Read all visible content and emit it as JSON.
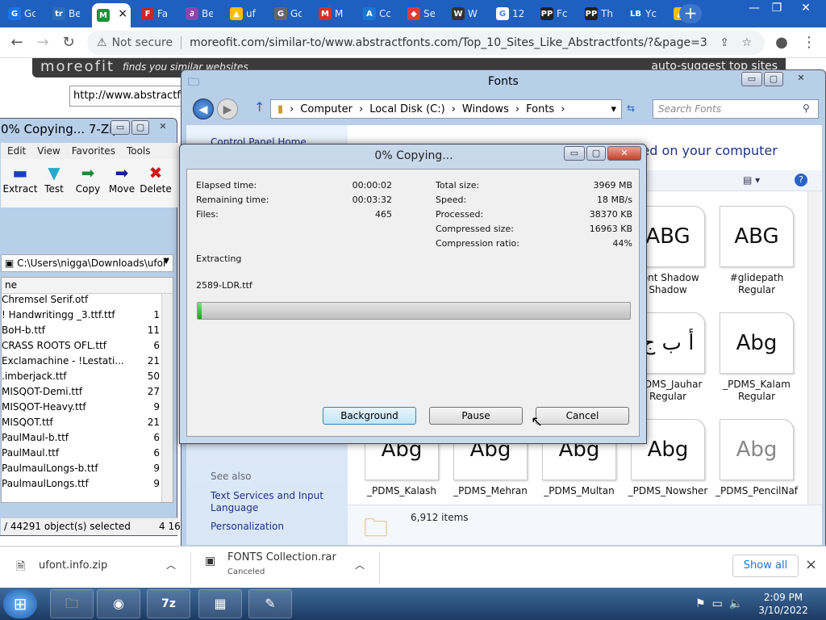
{
  "browser": {
    "tabs": [
      {
        "label": "Gc",
        "fav_color": "#1a73e8",
        "fav_text": "G"
      },
      {
        "label": "Be",
        "fav_color": "#2d6db5",
        "fav_text": "tr"
      },
      {
        "label": "",
        "fav_color": "#1f8f3a",
        "fav_text": "M",
        "active": true
      },
      {
        "label": "Fa",
        "fav_color": "#c62828",
        "fav_text": "F"
      },
      {
        "label": "Be",
        "fav_color": "#8e44ad",
        "fav_text": "∂"
      },
      {
        "label": "uf",
        "fav_color": "#fbbc04",
        "fav_text": "▲"
      },
      {
        "label": "Gc",
        "fav_color": "#666666",
        "fav_text": "G"
      },
      {
        "label": "M",
        "fav_color": "#d93025",
        "fav_text": "M"
      },
      {
        "label": "Cc",
        "fav_color": "#1976d2",
        "fav_text": "A"
      },
      {
        "label": "Se",
        "fav_color": "#e53935",
        "fav_text": "◆"
      },
      {
        "label": "W",
        "fav_color": "#333333",
        "fav_text": "W"
      },
      {
        "label": "12",
        "fav_color": "#ffffff",
        "fav_text": "G"
      },
      {
        "label": "Fc",
        "fav_color": "#222222",
        "fav_text": "PP"
      },
      {
        "label": "Th",
        "fav_color": "#222222",
        "fav_text": "PP"
      },
      {
        "label": "Yc",
        "fav_color": "#1565c0",
        "fav_text": "LB"
      },
      {
        "label": "Ur",
        "fav_color": "#fbbc04",
        "fav_text": "▲"
      }
    ],
    "close_glyph": "×",
    "new_tab": "+",
    "not_secure": "Not secure",
    "url": "moreofit.com/similar-to/www.abstractfonts.com/Top_10_Sites_Like_Abstractfonts/?&page=3"
  },
  "page": {
    "logo": "moreofit",
    "tagline": "finds you similar websites",
    "links": "auto-suggest   top sites",
    "url_box_value": "http://www.abstractfon"
  },
  "zip": {
    "title": "0% Copying... 7-Zip",
    "menu": [
      "Edit",
      "View",
      "Favorites",
      "Tools"
    ],
    "tools": [
      {
        "label": "Extract",
        "glyph": "▬",
        "color": "#1a3fc4"
      },
      {
        "label": "Test",
        "glyph": "▼",
        "color": "#22aacc"
      },
      {
        "label": "Copy",
        "glyph": "➡",
        "color": "#1c8a3a"
      },
      {
        "label": "Move",
        "glyph": "➡",
        "color": "#1a1a9a"
      },
      {
        "label": "Delete",
        "glyph": "✖",
        "color": "#d01818"
      }
    ],
    "path": "C:\\Users\\nigga\\Downloads\\ufor",
    "col_name": "ne",
    "rows": [
      {
        "name": "Chremsel Serif.otf",
        "size": ""
      },
      {
        "name": "! Handwritingg _3.ttf.ttf",
        "size": "1"
      },
      {
        "name": "BoH-b.ttf",
        "size": "11"
      },
      {
        "name": "CRASS ROOTS OFL.ttf",
        "size": "6"
      },
      {
        "name": "Exclamachine - !Lestati...",
        "size": "21"
      },
      {
        "name": ".imberjack.ttf",
        "size": "50"
      },
      {
        "name": "MISQOT-Demi.ttf",
        "size": "27"
      },
      {
        "name": "MISQOT-Heavy.ttf",
        "size": "9"
      },
      {
        "name": "MISQOT.ttf",
        "size": "21"
      },
      {
        "name": "PaulMaul-b.ttf",
        "size": "6"
      },
      {
        "name": "PaulMaul.ttf",
        "size": "6"
      },
      {
        "name": "PaulmaulLongs-b.ttf",
        "size": "9"
      },
      {
        "name": "PaulmaulLongs.ttf",
        "size": "9"
      }
    ],
    "status_left": "/ 44291 object(s) selected",
    "status_right": "4 16."
  },
  "fonts": {
    "title": "Fonts",
    "breadcrumb": [
      "Computer",
      "Local Disk (C:)",
      "Windows",
      "Fonts"
    ],
    "search_placeholder": "Search Fonts",
    "left_top_link": "Control Panel Home",
    "installed_text": "led on your computer",
    "see_also": "See also",
    "see_also_links": [
      "Text Services and Input Language",
      "Personalization"
    ],
    "tiles": [
      {
        "sample": "ABG",
        "label": "Font Shadow Shadow"
      },
      {
        "sample": "ABG",
        "label": "#glidepath Regular"
      },
      {
        "sample": "أ ب ج",
        "label": "_PDMS_Jauhar Regular"
      },
      {
        "sample": "Abg",
        "label": "_PDMS_Kalam Regular"
      },
      {
        "sample": "Abg",
        "label": "_PDMS_Kalash"
      },
      {
        "sample": "Abg",
        "label": "_PDMS_Mehran"
      },
      {
        "sample": "Abg",
        "label": "_PDMS_Multan"
      },
      {
        "sample": "Abg",
        "label": "_PDMS_Nowsher"
      },
      {
        "sample": "Abg",
        "label": "_PDMS_PencilNaf"
      }
    ],
    "item_count": "6,912 items"
  },
  "dialog": {
    "title": "0% Copying...",
    "elapsed_label": "Elapsed time:",
    "elapsed": "00:00:02",
    "remaining_label": "Remaining time:",
    "remaining": "00:03:32",
    "files_label": "Files:",
    "files": "465",
    "total_size_label": "Total size:",
    "total_size": "3969 MB",
    "speed_label": "Speed:",
    "speed": "18 MB/s",
    "processed_label": "Processed:",
    "processed": "38370 KB",
    "compressed_label": "Compressed size:",
    "compressed": "16963 KB",
    "ratio_label": "Compression ratio:",
    "ratio": "44%",
    "action": "Extracting",
    "current_file": "2589-LDR.ttf",
    "progress": 0.009,
    "buttons": {
      "background": "Background",
      "pause": "Pause",
      "cancel": "Cancel"
    }
  },
  "downloads": {
    "items": [
      {
        "name": "ufont.info.zip",
        "status": ""
      },
      {
        "name": "FONTS Collection.rar",
        "status": "Canceled"
      }
    ],
    "show_all": "Show all",
    "close": "×"
  },
  "taskbar": {
    "start": "⊞",
    "time": "2:09 PM",
    "date": "3/10/2022"
  }
}
